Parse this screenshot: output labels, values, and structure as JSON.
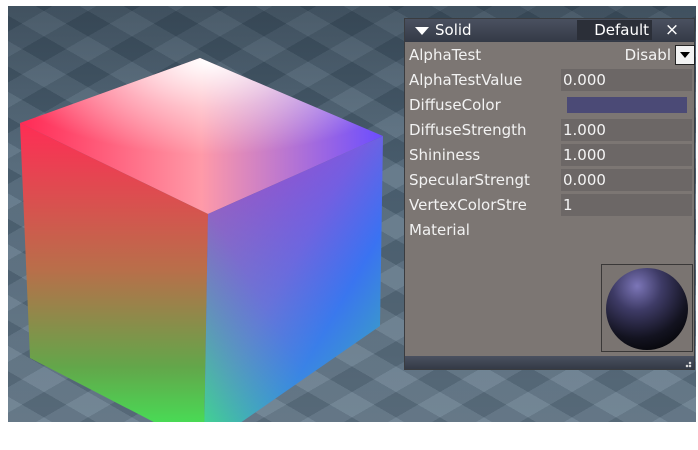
{
  "panel": {
    "title": "Solid",
    "preset": "Default",
    "close_glyph": "×",
    "collapse_icon": "triangle-down-icon",
    "rows": {
      "alpha_test": {
        "label": "AlphaTest",
        "value": "Disabl"
      },
      "alpha_test_value": {
        "label": "AlphaTestValue",
        "value": "0.000"
      },
      "diffuse_color": {
        "label": "DiffuseColor",
        "color": "#4b4a76"
      },
      "diffuse_strength": {
        "label": "DiffuseStrength",
        "value": "1.000"
      },
      "shininess": {
        "label": "Shininess",
        "value": "1.000"
      },
      "specular_strength": {
        "label": "SpecularStrengt",
        "value": "0.000"
      },
      "vertex_color_strength": {
        "label": "VertexColorStre",
        "value": "1"
      },
      "material": {
        "label": "Material"
      }
    }
  },
  "viewport": {
    "object": "rgb-color-cube",
    "background_color": "#52697c"
  }
}
